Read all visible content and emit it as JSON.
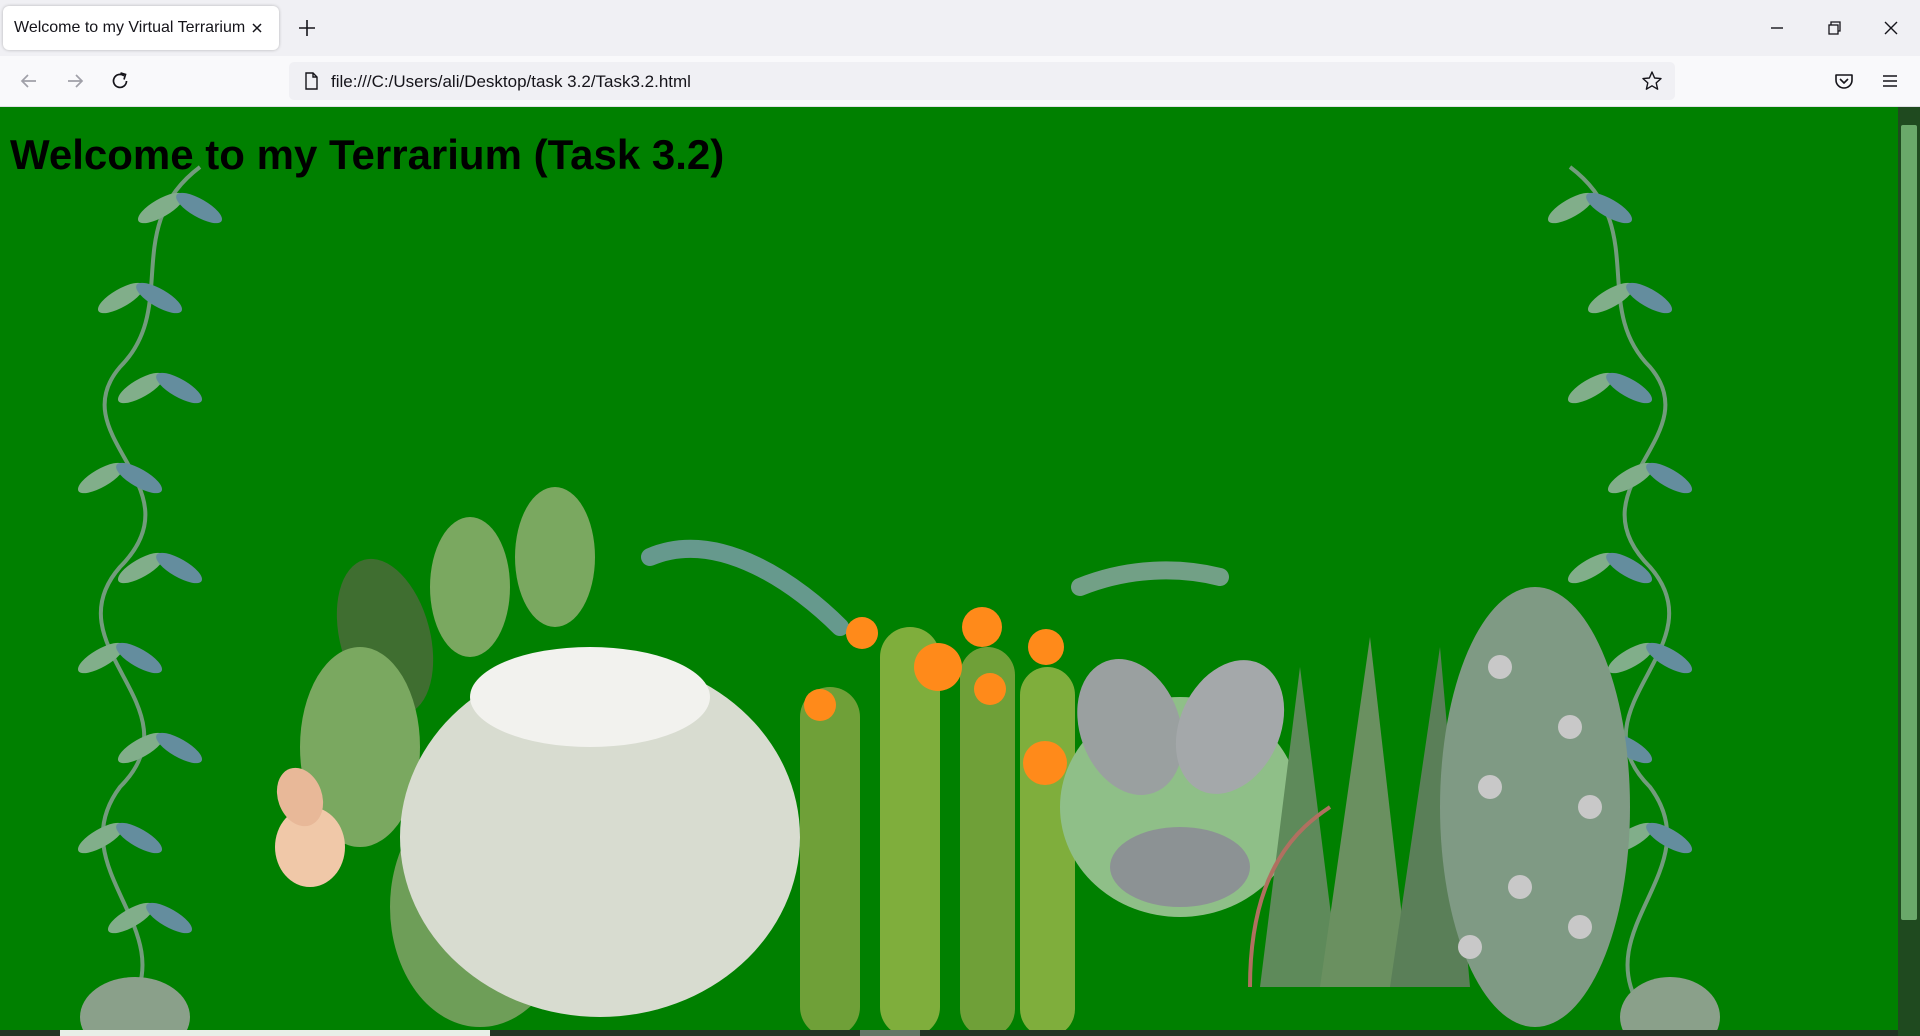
{
  "browser": {
    "tab_title": "Welcome to my Virtual Terrarium",
    "url": "file:///C:/Users/ali/Desktop/task 3.2/Task3.2.html"
  },
  "page": {
    "heading": "Welcome to my Terrarium (Task 3.2)",
    "background_color": "#008000"
  },
  "icons": {
    "tab_close": "close-icon",
    "new_tab": "plus-icon",
    "minimize": "minimize-icon",
    "restore": "restore-icon",
    "close_window": "close-icon",
    "back": "back-arrow-icon",
    "forward": "forward-arrow-icon",
    "reload": "reload-icon",
    "page": "page-icon",
    "bookmark": "star-icon",
    "pocket": "pocket-icon",
    "menu": "hamburger-menu-icon"
  }
}
